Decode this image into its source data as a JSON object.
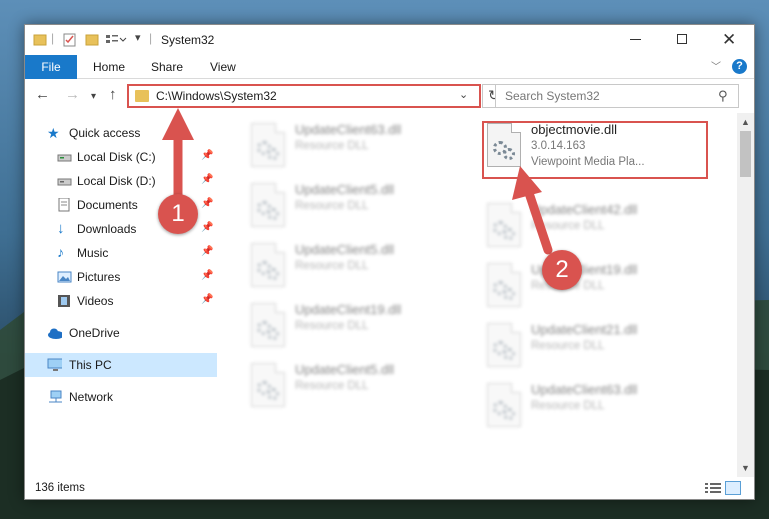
{
  "window": {
    "title": "System32"
  },
  "ribbon": {
    "tabs": [
      "File",
      "Home",
      "Share",
      "View"
    ],
    "help": "?"
  },
  "address_bar": {
    "path": "C:\\Windows\\System32",
    "search_placeholder": "Search System32"
  },
  "nav_pane": {
    "items": [
      {
        "label": "Quick access",
        "icon": "star-icon",
        "pinned": false
      },
      {
        "label": "Local Disk (C:)",
        "icon": "drive-icon",
        "pinned": true
      },
      {
        "label": "Local Disk (D:)",
        "icon": "drive-icon",
        "pinned": true
      },
      {
        "label": "Documents",
        "icon": "documents-icon",
        "pinned": true
      },
      {
        "label": "Downloads",
        "icon": "download-icon",
        "pinned": true
      },
      {
        "label": "Music",
        "icon": "music-icon",
        "pinned": true
      },
      {
        "label": "Pictures",
        "icon": "pictures-icon",
        "pinned": true
      },
      {
        "label": "Videos",
        "icon": "videos-icon",
        "pinned": true
      },
      {
        "label": "OneDrive",
        "icon": "cloud-icon",
        "pinned": false
      },
      {
        "label": "This PC",
        "icon": "computer-icon",
        "pinned": false,
        "selected": true
      },
      {
        "label": "Network",
        "icon": "network-icon",
        "pinned": false
      }
    ]
  },
  "files": {
    "left_column": [
      {
        "name": "UpdateClient63.dll",
        "type": "Resource DLL"
      },
      {
        "name": "UpdateClient5.dll",
        "type": "Resource DLL"
      },
      {
        "name": "UpdateClient5.dll",
        "type": "Resource DLL"
      },
      {
        "name": "UpdateClient19.dll",
        "type": "Resource DLL"
      },
      {
        "name": "UpdateClient5.dll",
        "type": "Resource DLL"
      }
    ],
    "highlighted": {
      "name": "objectmovie.dll",
      "version": "3.0.14.163",
      "description": "Viewpoint Media Pla..."
    },
    "right_column": [
      {
        "name": "UpdateClient42.dll",
        "type": "Resource DLL"
      },
      {
        "name": "UpdateClient19.dll",
        "type": "Resource DLL"
      },
      {
        "name": "UpdateClient21.dll",
        "type": "Resource DLL"
      },
      {
        "name": "UpdateClient63.dll",
        "type": "Resource DLL"
      }
    ]
  },
  "status": {
    "item_count": "136 items"
  },
  "annotations": {
    "step1": "1",
    "step2": "2"
  },
  "colors": {
    "accent": "#1979ca",
    "highlight": "#d9534f",
    "selected": "#cce8ff"
  }
}
